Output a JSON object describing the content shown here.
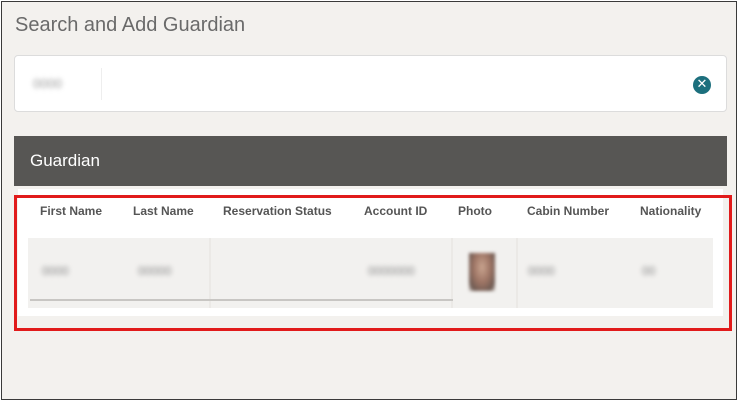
{
  "panel": {
    "title": "Search and Add Guardian"
  },
  "search": {
    "value": "0000",
    "clear_icon": "clear-circle-icon"
  },
  "guardian_section": {
    "title": "Guardian"
  },
  "table": {
    "columns": [
      "First Name",
      "Last Name",
      "Reservation Status",
      "Account ID",
      "Photo",
      "Cabin Number",
      "Nationality"
    ],
    "rows": [
      {
        "first_name": "0000",
        "last_name": "00000",
        "reservation_status": "",
        "account_id": "0000000",
        "photo": "guardian-photo",
        "cabin_number": "0000",
        "nationality": "00"
      }
    ]
  },
  "colors": {
    "header_bar": "#575654",
    "clear_icon": "#1c6f7d",
    "highlight": "#e11b1b",
    "background": "#f3f1ee"
  }
}
